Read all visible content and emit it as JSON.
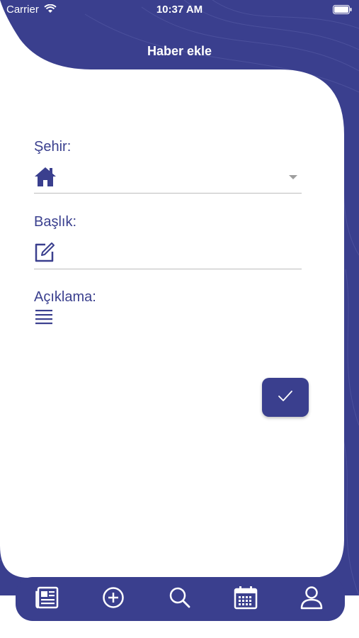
{
  "status_bar": {
    "carrier": "Carrier",
    "time": "10:37 AM"
  },
  "header": {
    "title": "Haber ekle"
  },
  "form": {
    "city_label": "Şehir:",
    "city_value": "",
    "title_label": "Başlık:",
    "title_value": "",
    "description_label": "Açıklama:",
    "description_value": ""
  },
  "submit": {
    "icon": "check-icon"
  },
  "tabbar": {
    "items": [
      {
        "icon": "news-icon"
      },
      {
        "icon": "add-circle-icon"
      },
      {
        "icon": "search-icon"
      },
      {
        "icon": "calendar-icon"
      },
      {
        "icon": "profile-icon"
      }
    ]
  },
  "colors": {
    "primary": "#3a3f8e",
    "background": "#ffffff",
    "divider": "#bdbdbd"
  }
}
